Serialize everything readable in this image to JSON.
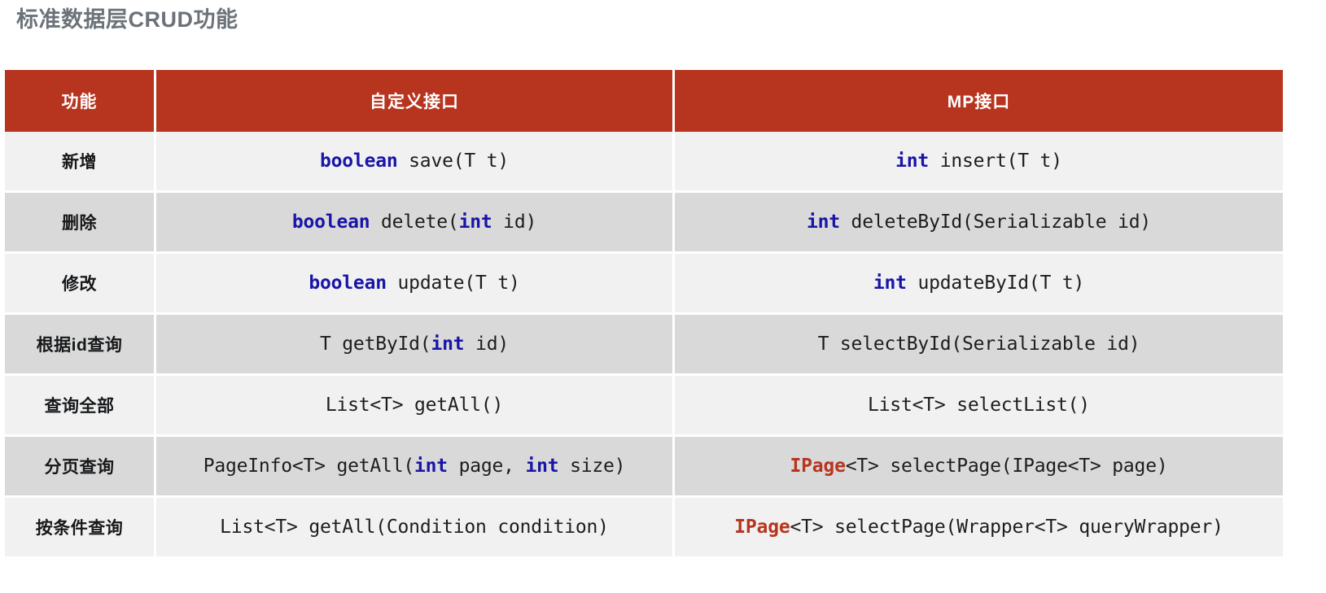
{
  "page": {
    "title": "标准数据层CRUD功能",
    "title_color": "#6c7279",
    "background": "#ffffff"
  },
  "table": {
    "header_bg": "#b7351f",
    "header_text_color": "#ffffff",
    "row_light_bg": "#f1f1f1",
    "row_dark_bg": "#d9d9d9",
    "keyword_color": "#1815a8",
    "accent_type_color": "#b7351f",
    "columns": [
      {
        "key": "feature",
        "label": "功能"
      },
      {
        "key": "custom",
        "label": "自定义接口"
      },
      {
        "key": "mp",
        "label": "MP接口"
      }
    ],
    "rows": [
      {
        "feature": "新增",
        "custom_plain": "boolean save(T t)",
        "custom_parts": [
          {
            "text": "boolean",
            "style": "keyword"
          },
          {
            "text": " save(T t)",
            "style": "plain"
          }
        ],
        "mp_plain": "int insert(T t)",
        "mp_parts": [
          {
            "text": "int",
            "style": "keyword"
          },
          {
            "text": " insert(T t)",
            "style": "plain"
          }
        ]
      },
      {
        "feature": "删除",
        "custom_plain": "boolean delete(int id)",
        "custom_parts": [
          {
            "text": "boolean",
            "style": "keyword"
          },
          {
            "text": " delete(",
            "style": "plain"
          },
          {
            "text": "int",
            "style": "keyword"
          },
          {
            "text": " id)",
            "style": "plain"
          }
        ],
        "mp_plain": "int deleteById(Serializable id)",
        "mp_parts": [
          {
            "text": "int",
            "style": "keyword"
          },
          {
            "text": " deleteById(Serializable id)",
            "style": "plain"
          }
        ]
      },
      {
        "feature": "修改",
        "custom_plain": "boolean update(T t)",
        "custom_parts": [
          {
            "text": "boolean",
            "style": "keyword"
          },
          {
            "text": " update(T t)",
            "style": "plain"
          }
        ],
        "mp_plain": "int updateById(T t)",
        "mp_parts": [
          {
            "text": "int",
            "style": "keyword"
          },
          {
            "text": " updateById(T t)",
            "style": "plain"
          }
        ]
      },
      {
        "feature": "根据id查询",
        "custom_plain": "T getById(int id)",
        "custom_parts": [
          {
            "text": "T getById(",
            "style": "plain"
          },
          {
            "text": "int",
            "style": "keyword"
          },
          {
            "text": " id)",
            "style": "plain"
          }
        ],
        "mp_plain": "T selectById(Serializable id)",
        "mp_parts": [
          {
            "text": "T selectById(Serializable id)",
            "style": "plain"
          }
        ]
      },
      {
        "feature": "查询全部",
        "custom_plain": "List<T> getAll()",
        "custom_parts": [
          {
            "text": "List<T> getAll()",
            "style": "plain"
          }
        ],
        "mp_plain": "List<T> selectList()",
        "mp_parts": [
          {
            "text": "List<T> selectList()",
            "style": "plain"
          }
        ]
      },
      {
        "feature": "分页查询",
        "custom_plain": "PageInfo<T> getAll(int page, int size)",
        "custom_parts": [
          {
            "text": "PageInfo<T> getAll(",
            "style": "plain"
          },
          {
            "text": "int",
            "style": "keyword"
          },
          {
            "text": " page, ",
            "style": "plain"
          },
          {
            "text": "int",
            "style": "keyword"
          },
          {
            "text": " size)",
            "style": "plain"
          }
        ],
        "mp_plain": "IPage<T> selectPage(IPage<T> page)",
        "mp_parts": [
          {
            "text": "IPage",
            "style": "accent"
          },
          {
            "text": "<T> selectPage(IPage<T> page)",
            "style": "plain"
          }
        ]
      },
      {
        "feature": "按条件查询",
        "custom_plain": "List<T> getAll(Condition condition)",
        "custom_parts": [
          {
            "text": "List<T> getAll(Condition condition)",
            "style": "plain"
          }
        ],
        "mp_plain": "IPage<T> selectPage(Wrapper<T> queryWrapper)",
        "mp_parts": [
          {
            "text": "IPage",
            "style": "accent"
          },
          {
            "text": "<T> selectPage(Wrapper<T> queryWrapper)",
            "style": "plain"
          }
        ]
      }
    ]
  }
}
